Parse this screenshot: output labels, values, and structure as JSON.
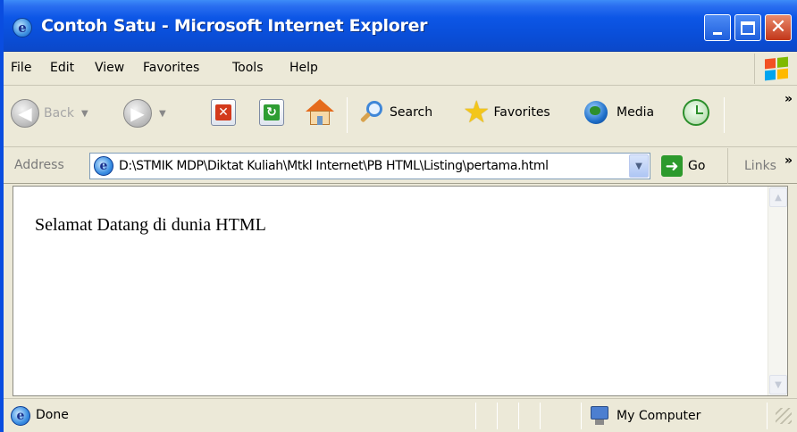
{
  "window": {
    "title": "Contoh Satu - Microsoft Internet Explorer",
    "icon": "ie-icon",
    "controls": [
      "minimize-icon",
      "maximize-icon",
      "close-icon"
    ]
  },
  "menu": {
    "items": [
      "File",
      "Edit",
      "View",
      "Favorites",
      "Tools",
      "Help"
    ]
  },
  "toolbar": {
    "back_label": "Back",
    "search_label": "Search",
    "favorites_label": "Favorites",
    "media_label": "Media",
    "overflow": "»"
  },
  "address": {
    "label": "Address",
    "value": "D:\\STMIK MDP\\Diktat Kuliah\\Mtkl Internet\\PB HTML\\Listing\\pertama.html",
    "go_label": "Go",
    "links_label": "Links",
    "overflow": "»"
  },
  "page": {
    "text": "Selamat Datang di dunia HTML"
  },
  "status": {
    "text": "Done",
    "zone": "My Computer"
  },
  "colors": {
    "titlebar": "#0a4ed8",
    "chrome": "#ece9d8",
    "close_button": "#c2361a"
  }
}
